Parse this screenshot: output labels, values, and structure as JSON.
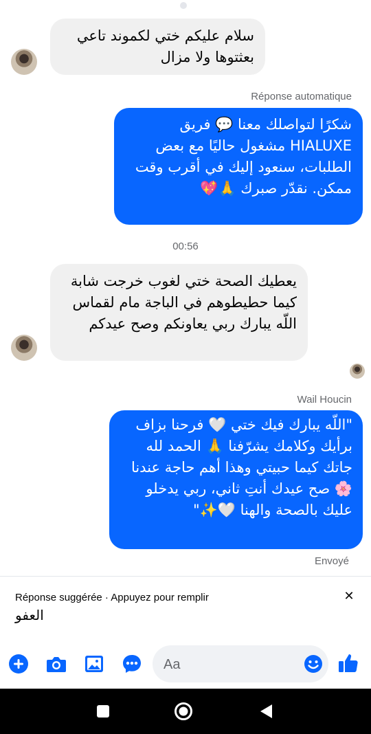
{
  "messages": [
    {
      "id": "m1",
      "from": "contact",
      "text": "سلام عليكم ختي لكموند تاعي بعثتوها ولا مزال"
    },
    {
      "id": "m2",
      "from": "me",
      "sender_label": "Réponse automatique",
      "text": "شكرًا لتواصلك معنا 💬 فريق HIALUXE مشغول حاليًا مع بعض الطلبات، سنعود إليك في أقرب وقت ممكن. نقدّر صبرك 🙏💖"
    },
    {
      "id": "m3",
      "from": "contact",
      "text": "يعطيك الصحة ختي لغوب خرجت شابة كيما حطيطوهم في الباجة مام لقماس  اللّه يبارك ربي يعاونكم  وصح عيدكم"
    },
    {
      "id": "m4",
      "from": "me",
      "sender_label": "Wail Houcin",
      "text": "\"اللّه يبارك فيك ختي 🤍 فرحنا بزاف برأيك وكلامك يشرّفنا 🙏 الحمد لله جاتك كيما حبيتي وهذا أهم حاجة عندنا 🌸 صح عيدك أنتِ ثاني، ربي يدخلو عليك بالصحة والهنا 🤍✨\"",
      "status": "Envoyé"
    }
  ],
  "timestamp": "00:56",
  "suggestion": {
    "header": "Réponse suggérée · Appuyez pour remplir",
    "item": "العفو",
    "close_icon": "close-icon"
  },
  "composer": {
    "placeholder": "Aa"
  },
  "toolbar": {
    "icons": [
      "plus-icon",
      "camera-icon",
      "gallery-icon",
      "chat-options-icon",
      "emoji-icon",
      "like-icon"
    ]
  },
  "colors": {
    "accent": "#0866ff",
    "incoming_bubble": "#f0f0f0",
    "meta_text": "#65676b"
  }
}
